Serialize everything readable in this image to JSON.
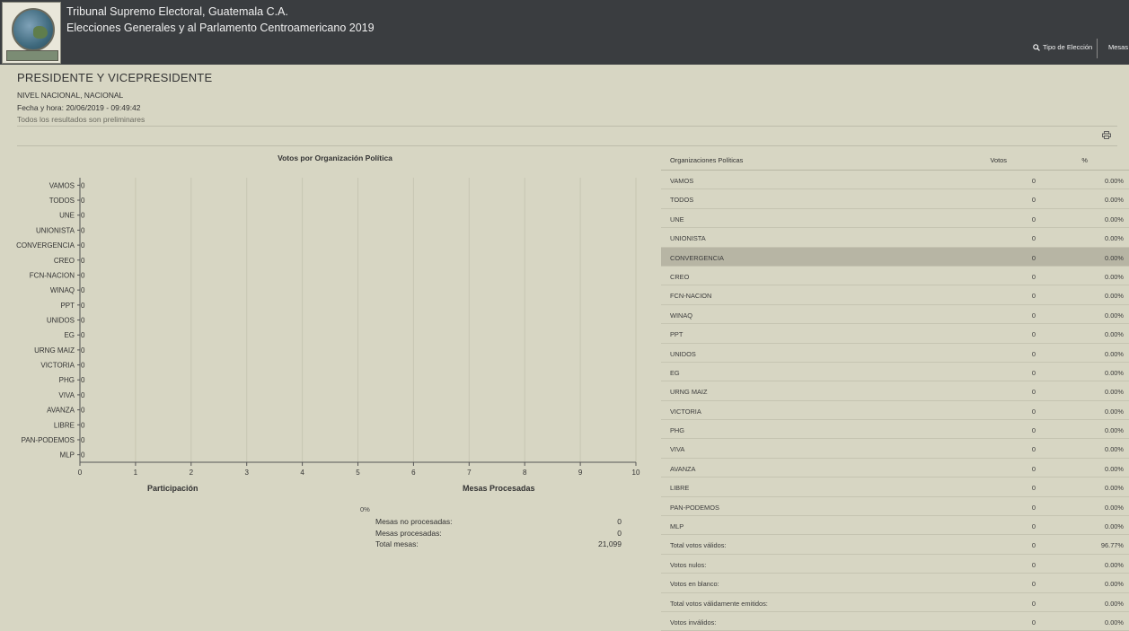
{
  "header": {
    "title_line1": "Tribunal Supremo Electoral, Guatemala C.A.",
    "title_line2": "Elecciones Generales y al Parlamento Centroamericano 2019",
    "nav": {
      "tipo_label": "Tipo de Elección",
      "mesas_label": "Mesas"
    }
  },
  "page": {
    "heading": "PRESIDENTE Y VICEPRESIDENTE",
    "nivel": "NIVEL NACIONAL, NACIONAL",
    "fecha": "Fecha y hora: 20/06/2019 - 09:49:42",
    "prelim_note": "Todos los resultados son preliminares"
  },
  "chart_data": {
    "type": "bar",
    "title": "Votos por Organización Política",
    "categories": [
      "VAMOS",
      "TODOS",
      "UNE",
      "UNIONISTA",
      "CONVERGENCIA",
      "CREO",
      "FCN-NACION",
      "WINAQ",
      "PPT",
      "UNIDOS",
      "EG",
      "URNG MAIZ",
      "VICTORIA",
      "PHG",
      "VIVA",
      "AVANZA",
      "LIBRE",
      "PAN-PODEMOS",
      "MLP"
    ],
    "values": [
      0,
      0,
      0,
      0,
      0,
      0,
      0,
      0,
      0,
      0,
      0,
      0,
      0,
      0,
      0,
      0,
      0,
      0,
      0
    ],
    "xticks": [
      "0",
      "1",
      "2",
      "3",
      "4",
      "5",
      "6",
      "7",
      "8",
      "9",
      "10"
    ],
    "xlim": [
      0,
      10
    ],
    "orientation": "horizontal",
    "grid": true
  },
  "participacion": {
    "title": "Participación"
  },
  "mesas_procesadas": {
    "title": "Mesas Procesadas",
    "pie_label": "0%",
    "rows": [
      {
        "label": "Mesas no procesadas:",
        "value": "0"
      },
      {
        "label": "Mesas procesadas:",
        "value": "0"
      },
      {
        "label": "Total mesas:",
        "value": "21,099"
      }
    ]
  },
  "table": {
    "headers": {
      "org": "Organizaciones Políticas",
      "votos": "Votos",
      "pct": "%"
    },
    "rows": [
      {
        "org": "VAMOS",
        "votos": "0",
        "pct": "0.00%"
      },
      {
        "org": "TODOS",
        "votos": "0",
        "pct": "0.00%"
      },
      {
        "org": "UNE",
        "votos": "0",
        "pct": "0.00%"
      },
      {
        "org": "UNIONISTA",
        "votos": "0",
        "pct": "0.00%"
      },
      {
        "org": "CONVERGENCIA",
        "votos": "0",
        "pct": "0.00%"
      },
      {
        "org": "CREO",
        "votos": "0",
        "pct": "0.00%"
      },
      {
        "org": "FCN-NACION",
        "votos": "0",
        "pct": "0.00%"
      },
      {
        "org": "WINAQ",
        "votos": "0",
        "pct": "0.00%"
      },
      {
        "org": "PPT",
        "votos": "0",
        "pct": "0.00%"
      },
      {
        "org": "UNIDOS",
        "votos": "0",
        "pct": "0.00%"
      },
      {
        "org": "EG",
        "votos": "0",
        "pct": "0.00%"
      },
      {
        "org": "URNG MAIZ",
        "votos": "0",
        "pct": "0.00%"
      },
      {
        "org": "VICTORIA",
        "votos": "0",
        "pct": "0.00%"
      },
      {
        "org": "PHG",
        "votos": "0",
        "pct": "0.00%"
      },
      {
        "org": "VIVA",
        "votos": "0",
        "pct": "0.00%"
      },
      {
        "org": "AVANZA",
        "votos": "0",
        "pct": "0.00%"
      },
      {
        "org": "LIBRE",
        "votos": "0",
        "pct": "0.00%"
      },
      {
        "org": "PAN-PODEMOS",
        "votos": "0",
        "pct": "0.00%"
      },
      {
        "org": "MLP",
        "votos": "0",
        "pct": "0.00%"
      },
      {
        "org": "Total votos válidos:",
        "votos": "0",
        "pct": "96.77%"
      },
      {
        "org": "Votos nulos:",
        "votos": "0",
        "pct": "0.00%"
      },
      {
        "org": "Votos en blanco:",
        "votos": "0",
        "pct": "0.00%"
      },
      {
        "org": "Total votos válidamente emitidos:",
        "votos": "0",
        "pct": "0.00%"
      },
      {
        "org": "Votos inválidos:",
        "votos": "0",
        "pct": "0.00%"
      }
    ],
    "highlight_row": 4
  },
  "colors": {
    "topbar": "#3a3d40",
    "background": "#d7d6c3",
    "highlight": "#b7b5a4"
  },
  "icons": {
    "search": "search-icon",
    "print": "print-icon"
  }
}
